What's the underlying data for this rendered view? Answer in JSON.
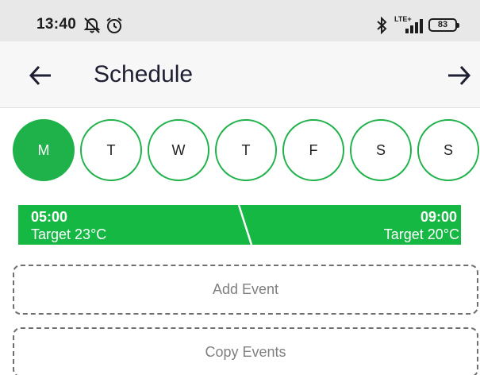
{
  "status_bar": {
    "time": "13:40",
    "network_label": "LTE+",
    "battery": "83",
    "icons": [
      "bell-off-icon",
      "alarm-icon",
      "bluetooth-icon",
      "signal-icon",
      "battery-icon"
    ]
  },
  "app_bar": {
    "title": "Schedule",
    "back_icon": "arrow-left-icon",
    "forward_icon": "arrow-right-icon"
  },
  "days": [
    {
      "label": "M",
      "selected": true
    },
    {
      "label": "T",
      "selected": false
    },
    {
      "label": "W",
      "selected": false
    },
    {
      "label": "T",
      "selected": false
    },
    {
      "label": "F",
      "selected": false
    },
    {
      "label": "S",
      "selected": false
    },
    {
      "label": "S",
      "selected": false
    }
  ],
  "timeline": {
    "start": {
      "time": "05:00",
      "target_label": "Target",
      "target_value": "23°C"
    },
    "end": {
      "time": "09:00",
      "target_label": "Target",
      "target_value": "20°C"
    }
  },
  "actions": {
    "add_event": "Add Event",
    "copy_events": "Copy Events"
  },
  "colors": {
    "accent": "#1fb24a",
    "timeline": "#16b844",
    "status_bar": "#e8e8e8",
    "app_bar": "#f7f7f7"
  }
}
